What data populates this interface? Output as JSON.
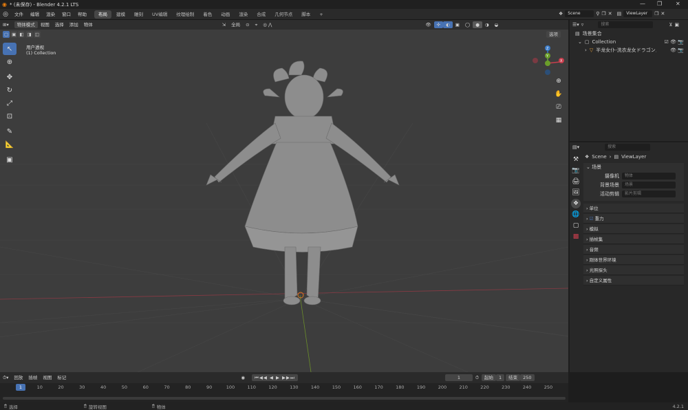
{
  "window": {
    "title": "* (未保存) - Blender 4.2.1 LTS"
  },
  "menu": {
    "items": [
      "文件",
      "编辑",
      "渲染",
      "窗口",
      "帮助"
    ]
  },
  "workspaces": [
    "布局",
    "建模",
    "雕刻",
    "UV编辑",
    "纹理绘制",
    "着色",
    "动画",
    "渲染",
    "合成",
    "几何节点",
    "脚本"
  ],
  "scene_selector": "Scene",
  "view_layer_selector": "ViewLayer",
  "viewport": {
    "mode": "物体模式",
    "menus": [
      "视图",
      "选择",
      "添加",
      "物体"
    ],
    "transform": "全局",
    "overlay_label": "用户透视",
    "collection_label": "(1) Collection",
    "options": "选项",
    "axes": {
      "x": "X",
      "y": "Y",
      "z": "Z"
    }
  },
  "outliner": {
    "search_placeholder": "搜索",
    "root": "场景集合",
    "collection": "Collection",
    "object": "半龙女仆-洗衣龙女ドラゴンメ"
  },
  "properties": {
    "search_placeholder": "搜索",
    "breadcrumb_scene": "Scene",
    "breadcrumb_layer": "ViewLayer",
    "section": "场景",
    "fields": [
      {
        "label": "摄像机",
        "placeholder": "物体"
      },
      {
        "label": "背景场景",
        "placeholder": "场景"
      },
      {
        "label": "活动剪辑",
        "placeholder": "影片剪辑"
      }
    ],
    "panels": [
      "单位",
      "重力",
      "模拟",
      "插帧集",
      "音频",
      "刚体世界环境",
      "光照探头",
      "自定义属性"
    ]
  },
  "timeline": {
    "menus": [
      "回放",
      "插帧",
      "视图",
      "标记"
    ],
    "current_frame": "1",
    "start_label": "起始",
    "start": "1",
    "end_label": "结束",
    "end": "250",
    "ticks": [
      "1",
      "10",
      "20",
      "30",
      "40",
      "50",
      "60",
      "70",
      "80",
      "90",
      "100",
      "110",
      "120",
      "130",
      "140",
      "150",
      "160",
      "170",
      "180",
      "190",
      "200",
      "210",
      "220",
      "230",
      "240",
      "250"
    ]
  },
  "status": {
    "left": "选择",
    "middle": "旋转视图",
    "right": "物体",
    "version": "4.2.1"
  },
  "colors": {
    "accent": "#4772b3",
    "x_axis": "#c83e4d",
    "y_axis": "#6b9e2a",
    "z_axis": "#3b7bc8",
    "viewport": "#3d3d3d"
  }
}
